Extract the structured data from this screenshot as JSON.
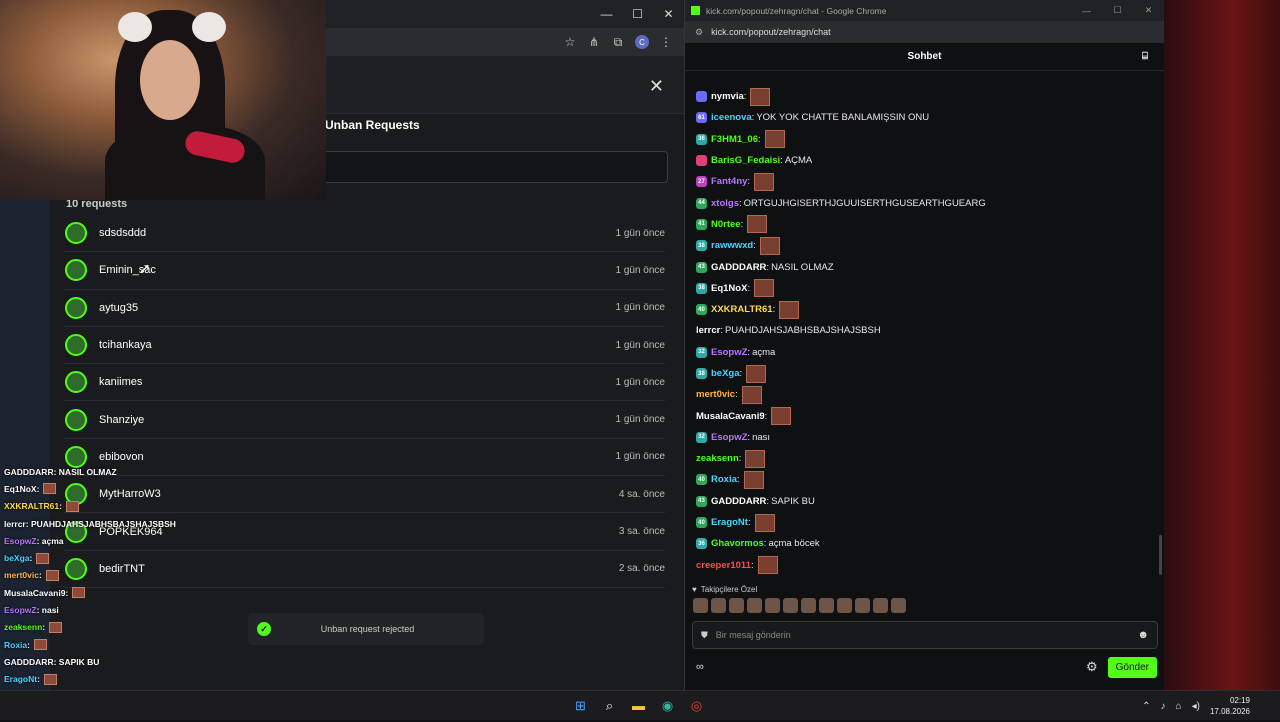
{
  "left_window": {
    "modal_tab": "Unban Requests",
    "request_count": "10 requests",
    "requests": [
      {
        "name": "sdsdsddd",
        "time": "1 gün önce"
      },
      {
        "name": "Eminin_sac",
        "time": "1 gün önce"
      },
      {
        "name": "aytug35",
        "time": "1 gün önce"
      },
      {
        "name": "tcihankaya",
        "time": "1 gün önce"
      },
      {
        "name": "kaniimes",
        "time": "1 gün önce"
      },
      {
        "name": "Shanziye",
        "time": "1 gün önce"
      },
      {
        "name": "ebibovon",
        "time": "1 gün önce"
      },
      {
        "name": "MytHarroW3",
        "time": "4 sa. önce"
      },
      {
        "name": "POPKEK964",
        "time": "3 sa. önce"
      },
      {
        "name": "bedirTNT",
        "time": "2 sa. önce"
      }
    ],
    "toast": "Unban request rejected"
  },
  "overlay_chat": [
    {
      "user": "GADDDARR",
      "text": ": NASIL OLMAZ",
      "color": "#ffffff",
      "emote": false
    },
    {
      "user": "Eq1NoX",
      "text": " :",
      "color": "#ffffff",
      "emote": true
    },
    {
      "user": "XXKRALTR61",
      "text": " :",
      "color": "#ffd84d",
      "emote": true
    },
    {
      "user": "lerrcr",
      "text": " : PUAHDJAHSJABHSBAJSHAJSBSH",
      "color": "#ffffff",
      "emote": false
    },
    {
      "user": "EsopwZ",
      "text": " : açma",
      "color": "#b775ff",
      "emote": false
    },
    {
      "user": "beXga",
      "text": " :",
      "color": "#4ad5ff",
      "emote": true
    },
    {
      "user": "mert0vic",
      "text": " :",
      "color": "#ffb347",
      "emote": true
    },
    {
      "user": "MusalaCavani9",
      "text": " :",
      "color": "#ffffff",
      "emote": true
    },
    {
      "user": "EsopwZ",
      "text": " : nasi",
      "color": "#b775ff",
      "emote": false
    },
    {
      "user": "zeaksenn",
      "text": " :",
      "color": "#53fc18",
      "emote": true
    },
    {
      "user": "Roxia",
      "text": " :",
      "color": "#4ad5ff",
      "emote": true
    },
    {
      "user": "GADDDARR",
      "text": " : SAPIK BU",
      "color": "#ffffff",
      "emote": false
    },
    {
      "user": "EragoNt",
      "text": " :",
      "color": "#4ad5ff",
      "emote": true
    },
    {
      "user": "Ghavormos",
      "text": " : açma böcek",
      "color": "#53fc18",
      "emote": false
    },
    {
      "user": "creeper1011",
      "text": " :",
      "color": "#ff4d4d",
      "emote": true
    }
  ],
  "right_window": {
    "window_title": "kick.com/popout/zehragn/chat - Google Chrome",
    "url": "kick.com/popout/zehragn/chat",
    "chat_title": "Sohbet",
    "messages": [
      {
        "badge": "",
        "badge_color": "#6b6bff",
        "user": "nymvia",
        "user_color": "#ffffff",
        "text": "",
        "emote": true
      },
      {
        "badge": "61",
        "badge_color": "#6b6bff",
        "user": "iceenova",
        "user_color": "#4ad5ff",
        "text": "YOK YOK CHATTE BANLAMIŞSIN ONU",
        "emote": false
      },
      {
        "badge": "36",
        "badge_color": "#2ea8a8",
        "user": "F3HM1_06",
        "user_color": "#53fc18",
        "text": "",
        "emote": true
      },
      {
        "badge": "",
        "badge_color": "#e0407a",
        "user": "BarisG_Fedaisi",
        "user_color": "#53fc18",
        "text": "AÇMA",
        "emote": false
      },
      {
        "badge": "27",
        "badge_color": "#c040c0",
        "user": "Fant4ny",
        "user_color": "#b775ff",
        "text": "",
        "emote": true
      },
      {
        "badge": "44",
        "badge_color": "#2ea85a",
        "user": "xtolgs",
        "user_color": "#b775ff",
        "text": "ORTGUJHGISERTHJGUUISERTHGUSEARTHGUEARG",
        "emote": false
      },
      {
        "badge": "41",
        "badge_color": "#2ea85a",
        "user": "N0rtee",
        "user_color": "#53fc18",
        "text": "",
        "emote": true
      },
      {
        "badge": "38",
        "badge_color": "#2ea8a8",
        "user": "rawwwxd",
        "user_color": "#4ad5ff",
        "text": "",
        "emote": true
      },
      {
        "badge": "43",
        "badge_color": "#2ea85a",
        "user": "GADDDARR",
        "user_color": "#ffffff",
        "text": "NASIL OLMAZ",
        "emote": false
      },
      {
        "badge": "38",
        "badge_color": "#2ea8a8",
        "user": "Eq1NoX",
        "user_color": "#ffffff",
        "text": "",
        "emote": true
      },
      {
        "badge": "40",
        "badge_color": "#2ea85a",
        "user": "XXKRALTR61",
        "user_color": "#ffd84d",
        "text": "",
        "emote": true
      },
      {
        "badge": "",
        "badge_color": "",
        "user": "lerrcr",
        "user_color": "#ffffff",
        "text": "PUAHDJAHSJABHSBAJSHAJSBSH",
        "emote": false
      },
      {
        "badge": "32",
        "badge_color": "#2ea8a8",
        "user": "EsopwZ",
        "user_color": "#b775ff",
        "text": "açma",
        "emote": false
      },
      {
        "badge": "38",
        "badge_color": "#2ea8a8",
        "user": "beXga",
        "user_color": "#4ad5ff",
        "text": "",
        "emote": true
      },
      {
        "badge": "",
        "badge_color": "",
        "user": "mert0vic",
        "user_color": "#ffb347",
        "text": "",
        "emote": true
      },
      {
        "badge": "",
        "badge_color": "",
        "user": "MusalaCavani9",
        "user_color": "#ffffff",
        "text": "",
        "emote": true
      },
      {
        "badge": "32",
        "badge_color": "#2ea8a8",
        "user": "EsopwZ",
        "user_color": "#b775ff",
        "text": "nası",
        "emote": false
      },
      {
        "badge": "",
        "badge_color": "",
        "user": "zeaksenn",
        "user_color": "#53fc18",
        "text": "",
        "emote": true
      },
      {
        "badge": "40",
        "badge_color": "#2ea85a",
        "user": "Roxia",
        "user_color": "#4ad5ff",
        "text": "",
        "emote": true
      },
      {
        "badge": "43",
        "badge_color": "#2ea85a",
        "user": "GADDDARR",
        "user_color": "#ffffff",
        "text": "SAPIK BU",
        "emote": false
      },
      {
        "badge": "40",
        "badge_color": "#2ea85a",
        "user": "EragoNt",
        "user_color": "#4ad5ff",
        "text": "",
        "emote": true
      },
      {
        "badge": "36",
        "badge_color": "#2ea8a8",
        "user": "Ghavormos",
        "user_color": "#53fc18",
        "text": "açma böcek",
        "emote": false
      },
      {
        "badge": "",
        "badge_color": "",
        "user": "creeper1011",
        "user_color": "#ff4d4d",
        "text": "",
        "emote": true
      }
    ],
    "followers_label": "Takipçilere Özel",
    "input_placeholder": "Bir mesaj gönderin",
    "send_label": "Gönder"
  },
  "taskbar": {
    "time": "02:19",
    "date": "17.08.2026"
  },
  "colors": {
    "kick_green": "#53fc18",
    "background": "#0f1012"
  }
}
